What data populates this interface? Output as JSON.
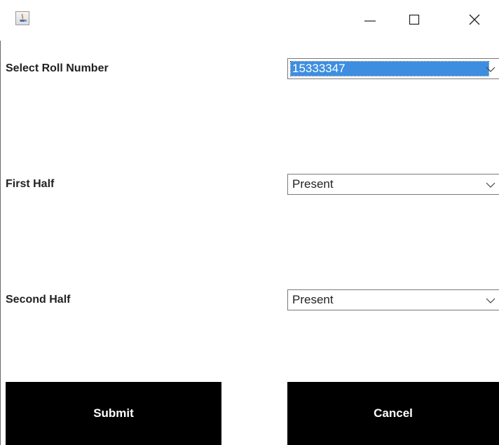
{
  "window": {
    "icons": {
      "app": "java-app-icon",
      "minimize": "minimize-icon",
      "maximize": "maximize-icon",
      "close": "close-icon"
    }
  },
  "form": {
    "roll_number": {
      "label": "Select Roll Number",
      "value": "15333347"
    },
    "first_half": {
      "label": "First Half",
      "value": "Present"
    },
    "second_half": {
      "label": "Second Half",
      "value": "Present"
    }
  },
  "buttons": {
    "submit_label": "Submit",
    "cancel_label": "Cancel"
  },
  "colors": {
    "button_bg": "#000000",
    "button_text": "#ffffff",
    "selection": "#3d8ee0"
  }
}
